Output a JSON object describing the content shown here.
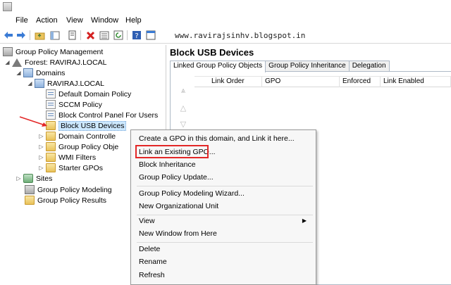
{
  "menubar": {
    "items": [
      "File",
      "Action",
      "View",
      "Window",
      "Help"
    ]
  },
  "toolbar": {
    "icons": [
      "back-icon",
      "forward-icon",
      "up-folder-icon",
      "show-hide-tree-icon",
      "properties-icon",
      "delete-icon",
      "export-list-icon",
      "refresh-icon",
      "help-icon",
      "console-icon"
    ],
    "url": "www.ravirajsinhv.blogspot.in"
  },
  "tree": {
    "root": "Group Policy Management",
    "forest": "Forest: RAVIRAJ.LOCAL",
    "domains": "Domains",
    "domain": "RAVIRAJ.LOCAL",
    "children": [
      "Default Domain Policy",
      "SCCM Policy",
      "Block Control Panel For Users",
      "Block USB Devices",
      "Domain Controlle",
      "Group Policy Obje",
      "WMI Filters",
      "Starter GPOs"
    ],
    "sites": "Sites",
    "modeling": "Group Policy Modeling",
    "results": "Group Policy Results"
  },
  "right": {
    "title": "Block USB Devices",
    "tabs": [
      "Linked Group Policy Objects",
      "Group Policy Inheritance",
      "Delegation"
    ],
    "columns": [
      "Link Order",
      "GPO",
      "Enforced",
      "Link Enabled"
    ]
  },
  "context_menu": {
    "items": [
      "Create a GPO in this domain, and Link it here...",
      "Link an Existing GPO...",
      "Block Inheritance",
      "Group Policy Update...",
      "Group Policy Modeling Wizard...",
      "New Organizational Unit",
      "View",
      "New Window from Here",
      "Delete",
      "Rename",
      "Refresh"
    ],
    "highlighted": "Link an Existing GPO..."
  },
  "colors": {
    "highlight_box": "#e32727",
    "selection": "#cce8ff",
    "annotation_arrow": "#e32727"
  }
}
